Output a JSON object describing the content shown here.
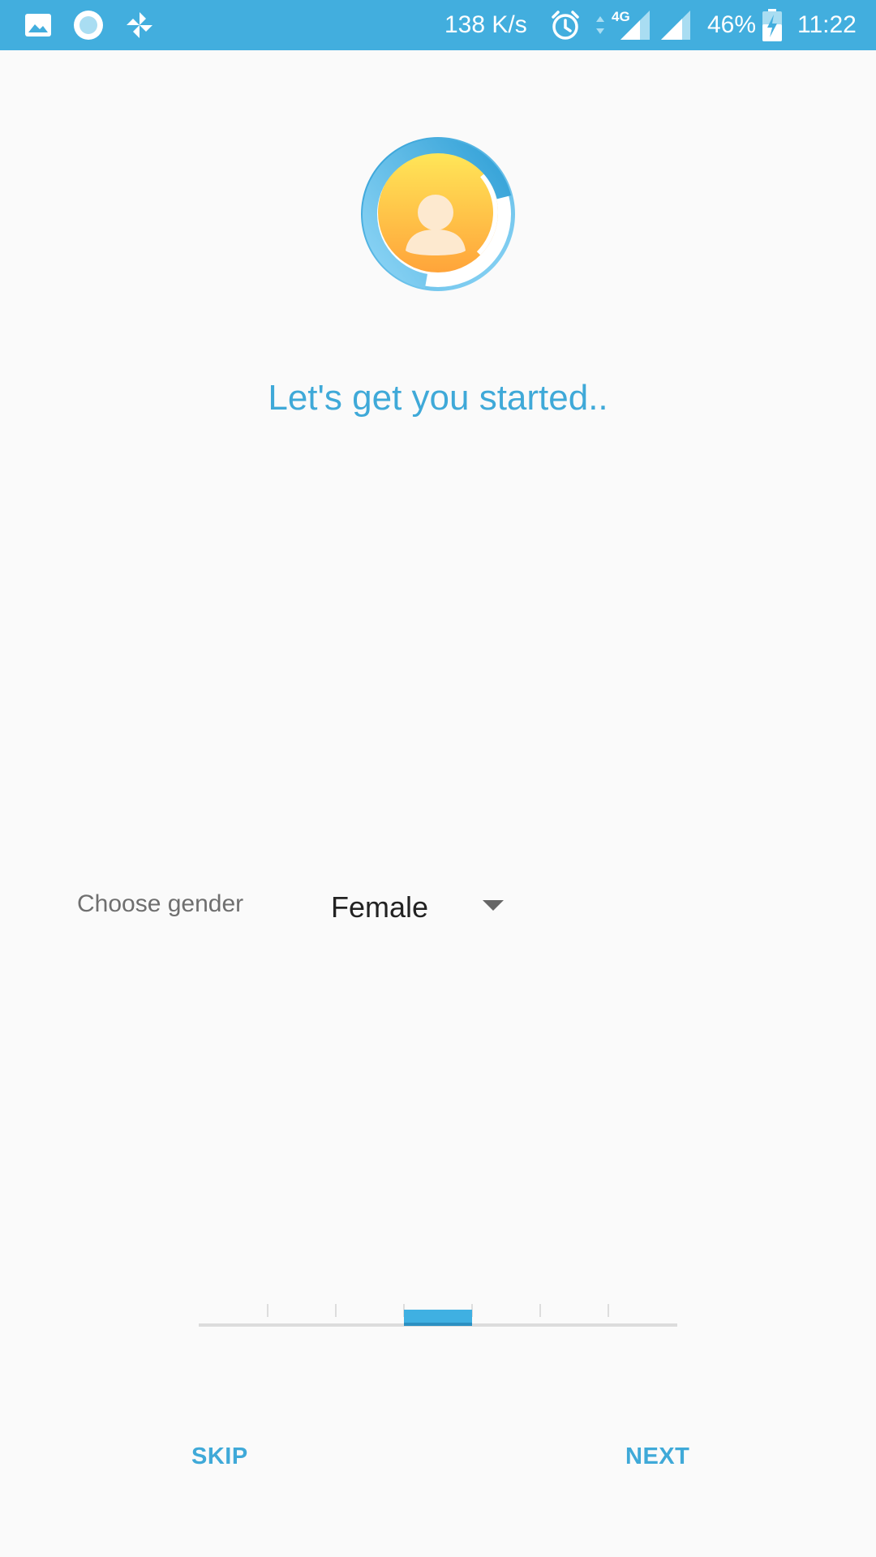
{
  "status_bar": {
    "left_icons": [
      "gallery-icon",
      "record-icon",
      "pinwheel-icon"
    ],
    "network_speed": "138 K/s",
    "network_type": "4G",
    "battery_percent": "46%",
    "time": "11:22",
    "background_color": "#42aede"
  },
  "onboarding": {
    "avatar_icon": "user-avatar-icon",
    "headline": "Let's get you started..",
    "gender_label": "Choose gender",
    "gender_value": "Female",
    "pager": {
      "page_count": 7,
      "current_page": 4
    },
    "skip_label": "SKIP",
    "next_label": "NEXT",
    "accent_color": "#3fa9d8"
  }
}
